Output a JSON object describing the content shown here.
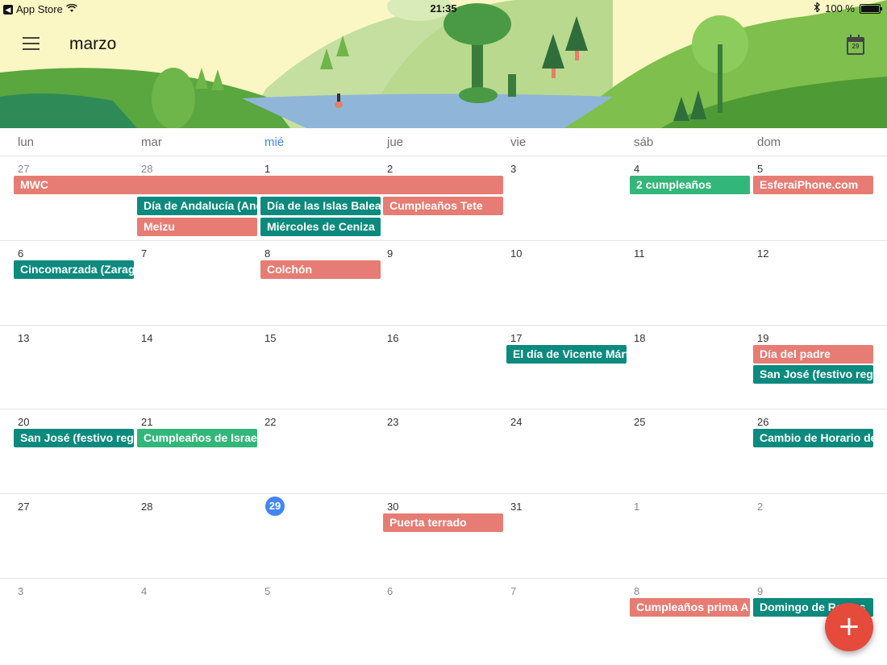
{
  "status_bar": {
    "back_app": "App Store",
    "time": "21:35",
    "battery": "100 %"
  },
  "header": {
    "month": "marzo",
    "today_day": "29",
    "icons": {
      "menu": "hamburger-menu-icon",
      "today": "calendar-today-icon",
      "wifi": "wifi-icon",
      "bluetooth": "bluetooth-icon"
    }
  },
  "weekdays": [
    "lun",
    "mar",
    "mié",
    "jue",
    "vie",
    "sáb",
    "dom"
  ],
  "today_weekday_index": 2,
  "weeks": [
    {
      "days": [
        "27",
        "28",
        "1",
        "2",
        "3",
        "4",
        "5"
      ],
      "other_month": [
        true,
        true,
        false,
        false,
        false,
        false,
        false
      ]
    },
    {
      "days": [
        "6",
        "7",
        "8",
        "9",
        "10",
        "11",
        "12"
      ],
      "other_month": [
        false,
        false,
        false,
        false,
        false,
        false,
        false
      ]
    },
    {
      "days": [
        "13",
        "14",
        "15",
        "16",
        "17",
        "18",
        "19"
      ],
      "other_month": [
        false,
        false,
        false,
        false,
        false,
        false,
        false
      ]
    },
    {
      "days": [
        "20",
        "21",
        "22",
        "23",
        "24",
        "25",
        "26"
      ],
      "other_month": [
        false,
        false,
        false,
        false,
        false,
        false,
        false
      ]
    },
    {
      "days": [
        "27",
        "28",
        "29",
        "30",
        "31",
        "1",
        "2"
      ],
      "other_month": [
        false,
        false,
        false,
        false,
        false,
        true,
        true
      ]
    },
    {
      "days": [
        "3",
        "4",
        "5",
        "6",
        "7",
        "8",
        "9"
      ],
      "other_month": [
        true,
        true,
        true,
        true,
        true,
        true,
        true
      ]
    }
  ],
  "today": {
    "week": 4,
    "day": 2
  },
  "events": [
    {
      "title": "MWC",
      "week": 0,
      "col": 0,
      "span": 4,
      "row": 0,
      "color": "red"
    },
    {
      "title": "2 cumpleaños",
      "week": 0,
      "col": 5,
      "span": 1,
      "row": 0,
      "color": "green"
    },
    {
      "title": "EsferaiPhone.com",
      "week": 0,
      "col": 6,
      "span": 1,
      "row": 0,
      "color": "red"
    },
    {
      "title": "Día de Andalucía (Andalucía)",
      "week": 0,
      "col": 1,
      "span": 1,
      "row": 1,
      "color": "teal"
    },
    {
      "title": "Día de las Islas Baleares",
      "week": 0,
      "col": 2,
      "span": 1,
      "row": 1,
      "color": "teal"
    },
    {
      "title": "Cumpleaños Tete",
      "week": 0,
      "col": 3,
      "span": 1,
      "row": 1,
      "color": "red"
    },
    {
      "title": "Meizu",
      "week": 0,
      "col": 1,
      "span": 1,
      "row": 2,
      "color": "red"
    },
    {
      "title": "Miércoles de Ceniza",
      "week": 0,
      "col": 2,
      "span": 1,
      "row": 2,
      "color": "teal"
    },
    {
      "title": "Cincomarzada (Zaragoza)",
      "week": 1,
      "col": 0,
      "span": 1,
      "row": 0,
      "color": "teal"
    },
    {
      "title": "Colchón",
      "week": 1,
      "col": 2,
      "span": 1,
      "row": 0,
      "color": "red"
    },
    {
      "title": "El día de Vicente Mártir",
      "week": 2,
      "col": 4,
      "span": 1,
      "row": 0,
      "color": "teal"
    },
    {
      "title": "Día del padre",
      "week": 2,
      "col": 6,
      "span": 1,
      "row": 0,
      "color": "red"
    },
    {
      "title": "San José (festivo regional)",
      "week": 2,
      "col": 6,
      "span": 1,
      "row": 1,
      "color": "teal"
    },
    {
      "title": "San José (festivo regional)",
      "week": 3,
      "col": 0,
      "span": 1,
      "row": 0,
      "color": "teal"
    },
    {
      "title": "Cumpleaños de Israel",
      "week": 3,
      "col": 1,
      "span": 1,
      "row": 0,
      "color": "green"
    },
    {
      "title": "Cambio de Horario de verano",
      "week": 3,
      "col": 6,
      "span": 1,
      "row": 0,
      "color": "teal"
    },
    {
      "title": "Puerta terrado",
      "week": 4,
      "col": 3,
      "span": 1,
      "row": 0,
      "color": "red"
    },
    {
      "title": "Cumpleaños prima A",
      "week": 5,
      "col": 5,
      "span": 1,
      "row": 0,
      "color": "red"
    },
    {
      "title": "Domingo de Ramos",
      "week": 5,
      "col": 6,
      "span": 1,
      "row": 0,
      "color": "teal"
    }
  ],
  "fab": {
    "label": "+",
    "icon": "add-icon",
    "color": "#e64a3b"
  },
  "colors": {
    "red": "#e67c73",
    "teal": "#0b8a7d",
    "green": "#33b679",
    "today": "#4285f4"
  }
}
